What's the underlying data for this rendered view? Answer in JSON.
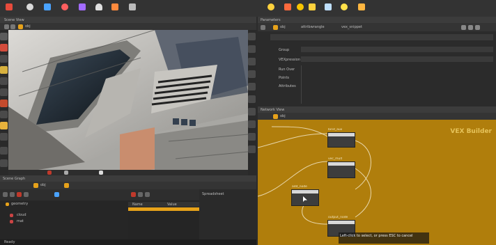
{
  "top_shelf": {
    "left_icons": [
      "cube-icon",
      "sphere-icon",
      "grid-icon",
      "light-icon",
      "box-icon",
      "figure-icon",
      "camera-icon",
      "skeleton-icon"
    ],
    "right_icons": [
      "light-icon",
      "spotlight-icon",
      "sun-icon",
      "env-icon",
      "sky-icon",
      "gi-icon",
      "flag-icon"
    ]
  },
  "scene_view": {
    "tab_label": "Scene View",
    "path_label": "obj"
  },
  "param_pane": {
    "tab_label": "Parameters",
    "path_label": "obj",
    "node_label": "attribwrangle",
    "node_name": "vex_snippet",
    "group_label": "Group",
    "group_value": "",
    "code_label": "VEXpression",
    "rows": [
      "Run Over",
      "Points",
      "Attributes"
    ]
  },
  "network": {
    "tab_label": "Network View",
    "path_label": "obj",
    "title": "VEX Builder",
    "nodes": [
      {
        "name": "bind_aux"
      },
      {
        "name": "vec_mult"
      },
      {
        "name": "add_node"
      },
      {
        "name": "output_node"
      }
    ],
    "tooltip": "Left-click to select, or press ESC to cancel"
  },
  "bottom": {
    "tree_tab": "Scene Graph",
    "tree_path": "obj",
    "tree_items": [
      "geometry",
      "cloud",
      "mat"
    ],
    "table_tab": "Spreadsheet",
    "table_cols": [
      "Name",
      "Value"
    ],
    "status": "Ready"
  },
  "colors": {
    "accent": "#e7a21a",
    "network_bg": "#b07e0c",
    "panel": "#2b2b2b"
  }
}
